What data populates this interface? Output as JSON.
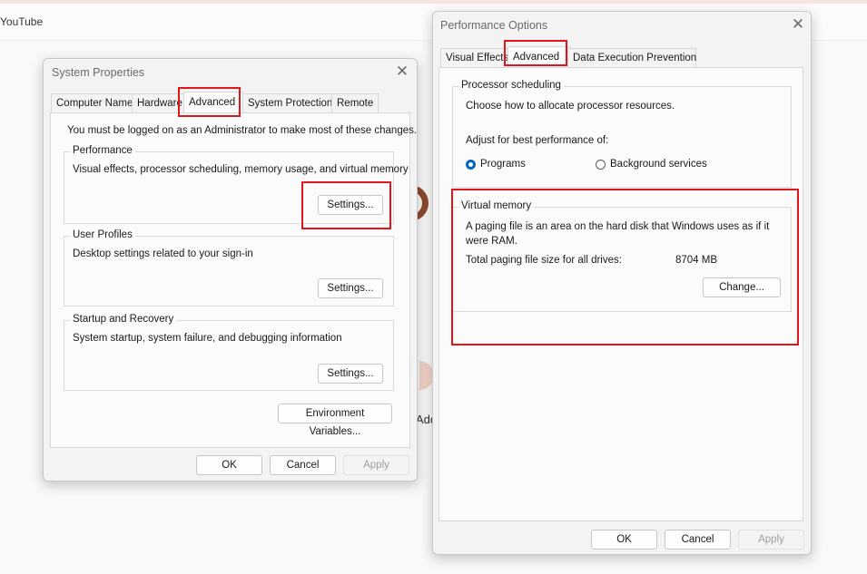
{
  "browser": {
    "tab_label": "YouTube"
  },
  "background": {
    "partial_text": "Add"
  },
  "system_properties": {
    "title": "System Properties",
    "tabs": [
      "Computer Name",
      "Hardware",
      "Advanced",
      "System Protection",
      "Remote"
    ],
    "active_tab": "Advanced",
    "admin_note": "You must be logged on as an Administrator to make most of these changes.",
    "performance": {
      "title": "Performance",
      "description": "Visual effects, processor scheduling, memory usage, and virtual memory",
      "button": "Settings..."
    },
    "user_profiles": {
      "title": "User Profiles",
      "description": "Desktop settings related to your sign-in",
      "button": "Settings..."
    },
    "startup_recovery": {
      "title": "Startup and Recovery",
      "description": "System startup, system failure, and debugging information",
      "button": "Settings..."
    },
    "env_button": "Environment Variables...",
    "ok": "OK",
    "cancel": "Cancel",
    "apply": "Apply"
  },
  "performance_options": {
    "title": "Performance Options",
    "tabs": [
      "Visual Effects",
      "Advanced",
      "Data Execution Prevention"
    ],
    "active_tab": "Advanced",
    "processor": {
      "title": "Processor scheduling",
      "description": "Choose how to allocate processor resources.",
      "adjust_label": "Adjust for best performance of:",
      "option_programs": "Programs",
      "option_background": "Background services",
      "selected": "Programs"
    },
    "virtual_memory": {
      "title": "Virtual memory",
      "description_line1": "A paging file is an area on the hard disk that Windows uses as if it",
      "description_line2": "were RAM.",
      "total_label": "Total paging file size for all drives:",
      "total_value": "8704 MB",
      "change_button": "Change..."
    },
    "ok": "OK",
    "cancel": "Cancel",
    "apply": "Apply"
  },
  "colors": {
    "highlight": "#e0161b",
    "radio_accent": "#0067c0"
  }
}
